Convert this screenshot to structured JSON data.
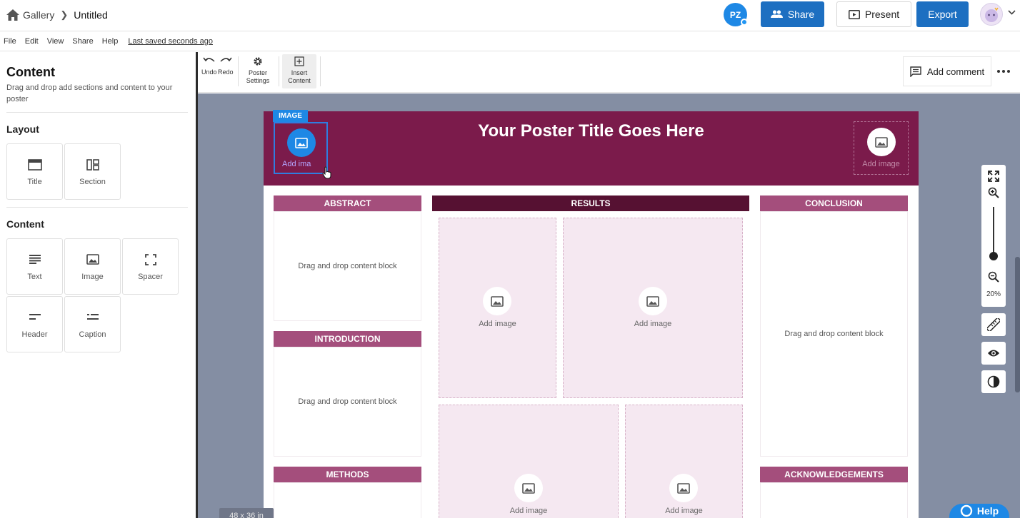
{
  "breadcrumb": {
    "home_label": "Gallery",
    "doc_title": "Untitled"
  },
  "collaborator": {
    "initials": "PZ"
  },
  "header_buttons": {
    "share": "Share",
    "present": "Present",
    "export": "Export"
  },
  "menu": {
    "items": [
      "File",
      "Edit",
      "View",
      "Share",
      "Help"
    ],
    "saved_status": "Last saved seconds ago"
  },
  "left_panel": {
    "title": "Content",
    "subtitle": "Drag and drop add sections and content to your poster",
    "layout_heading": "Layout",
    "layout_items": [
      "Title",
      "Section"
    ],
    "content_heading": "Content",
    "content_items": [
      "Text",
      "Image",
      "Spacer",
      "Header",
      "Caption"
    ]
  },
  "toolbar": {
    "undo": "Undo",
    "redo": "Redo",
    "poster_settings_1": "Poster",
    "poster_settings_2": "Settings",
    "insert_content_1": "Insert",
    "insert_content_2": "Content",
    "add_comment": "Add comment"
  },
  "poster": {
    "title": "Your Poster Title Goes Here",
    "image_tag": "IMAGE",
    "add_image": "Add image",
    "add_image_truncated": "Add ima",
    "drop_hint": "Drag and drop content block",
    "sections": {
      "abstract": "ABSTRACT",
      "introduction": "INTRODUCTION",
      "methods": "METHODS",
      "results": "RESULTS",
      "conclusion": "CONCLUSION",
      "acknowledgements": "ACKNOWLEDGEMENTS"
    }
  },
  "zoom": {
    "level": "20%"
  },
  "size_label": "48 x 36 in",
  "help_label": "Help",
  "colors": {
    "brand_blue": "#1d6fc1",
    "poster_header": "#7b1b4b",
    "section_pink": "#a44e7c",
    "section_dark": "#561132"
  }
}
